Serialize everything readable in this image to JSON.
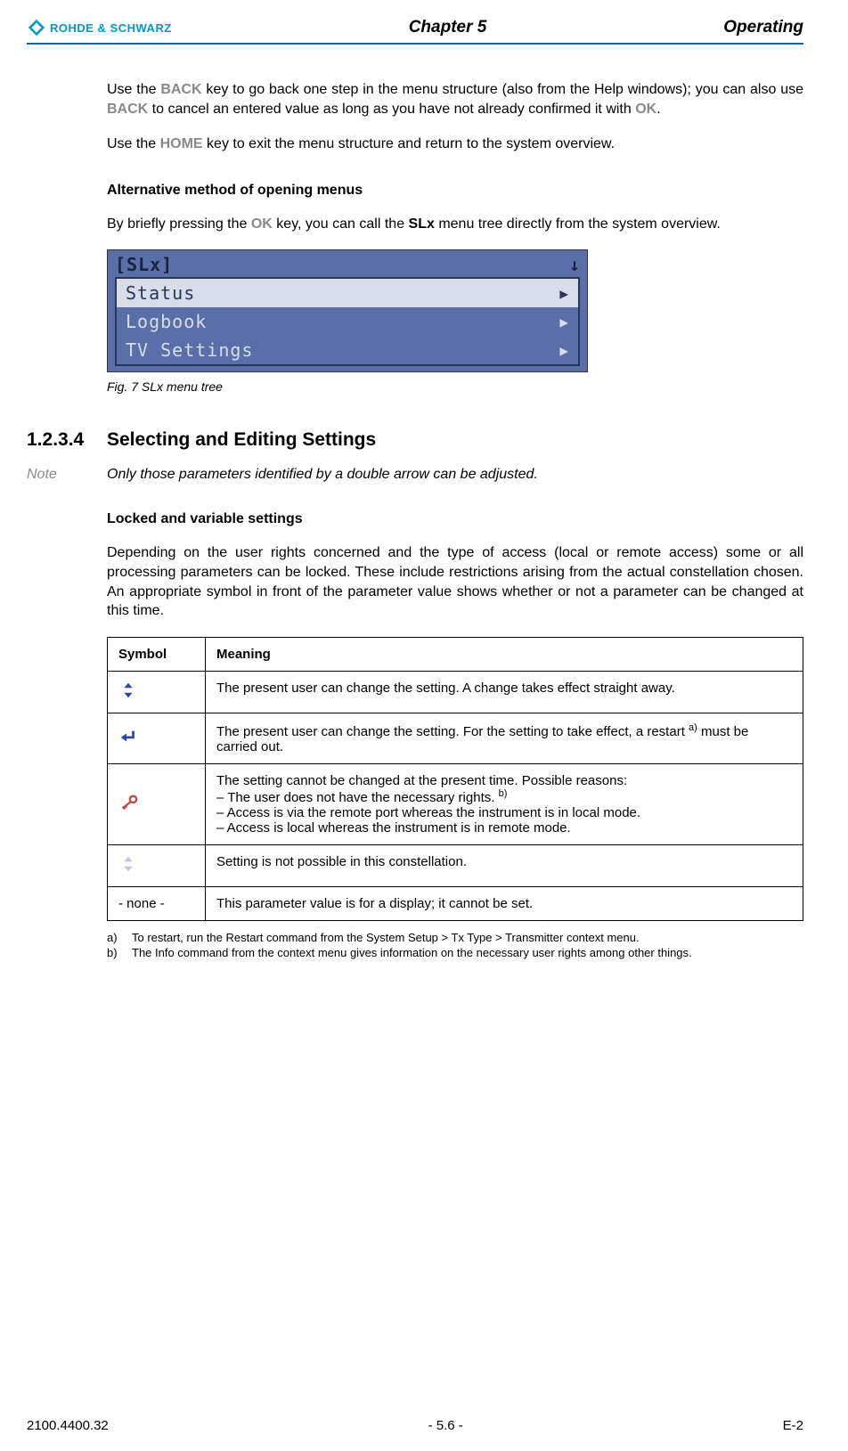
{
  "header": {
    "brand": "ROHDE & SCHWARZ",
    "chapter": "Chapter 5",
    "title": "Operating"
  },
  "intro": {
    "p1_a": "Use the ",
    "p1_key1": "BACK",
    "p1_b": " key to go back one step in the menu structure (also from the Help windows); you can also use ",
    "p1_key2": "BACK",
    "p1_c": " to cancel an entered value as long as you have not already confirmed it with ",
    "p1_key3": "OK",
    "p1_d": ".",
    "p2_a": "Use the ",
    "p2_key": "HOME",
    "p2_b": " key to exit the menu structure and return to the system overview."
  },
  "alt_method": {
    "heading": "Alternative method of opening menus",
    "p_a": "By briefly pressing the ",
    "p_key": "OK",
    "p_b": " key, you can call the ",
    "p_strong": "SLx",
    "p_c": " menu tree directly from the system overview."
  },
  "menu_shot": {
    "title": "[SLx]",
    "down_arrow": "↓",
    "items": [
      {
        "label": "Status",
        "arrow": "▶",
        "selected": true
      },
      {
        "label": "Logbook",
        "arrow": "▶",
        "selected": false
      },
      {
        "label": "TV Settings",
        "arrow": "▶",
        "selected": false
      }
    ]
  },
  "fig_caption": "Fig. 7  SLx menu tree",
  "section": {
    "number": "1.2.3.4",
    "title": "Selecting and Editing Settings"
  },
  "note": {
    "label": "Note",
    "text": "Only those parameters identified by a double arrow can be adjusted."
  },
  "locked": {
    "heading": "Locked and variable settings",
    "para": "Depending on the user rights concerned and the type of access (local or remote access) some or all processing parameters can be locked. These include restrictions arising from the actual constellation chosen. An appropriate symbol in front of the parameter value shows whether or not a parameter can be changed at this time."
  },
  "table": {
    "col1": "Symbol",
    "col2": "Meaning",
    "rows": [
      {
        "symbol_text": "",
        "meaning": "The present user can change the setting. A change takes effect straight away."
      },
      {
        "symbol_text": "",
        "meaning_a": "The present user can change the setting. For the setting to take effect, a restart ",
        "sup": "a)",
        "meaning_b": " must be carried out."
      },
      {
        "symbol_text": "",
        "meaning_head": "The setting cannot be changed at the present time. Possible reasons:",
        "sub1_a": "–  The user does not have the necessary rights. ",
        "sub1_sup": "b)",
        "sub2": "–  Access is via the remote port whereas the instrument is in local mode.",
        "sub3": "–  Access is local whereas the instrument is in remote mode."
      },
      {
        "symbol_text": "",
        "meaning": "Setting is not possible in this constellation."
      },
      {
        "symbol_text": "- none -",
        "meaning": "This parameter value is for a display; it cannot be set."
      }
    ]
  },
  "footnotes": {
    "a_label": "a)",
    "a_text": "To restart, run the Restart command from the System Setup > Tx Type > Transmitter context menu.",
    "b_label": "b)",
    "b_text": "The Info command from the context menu gives information on the necessary user rights among other things."
  },
  "footer": {
    "left": "2100.4400.32",
    "center": "- 5.6 -",
    "right": "E-2"
  }
}
